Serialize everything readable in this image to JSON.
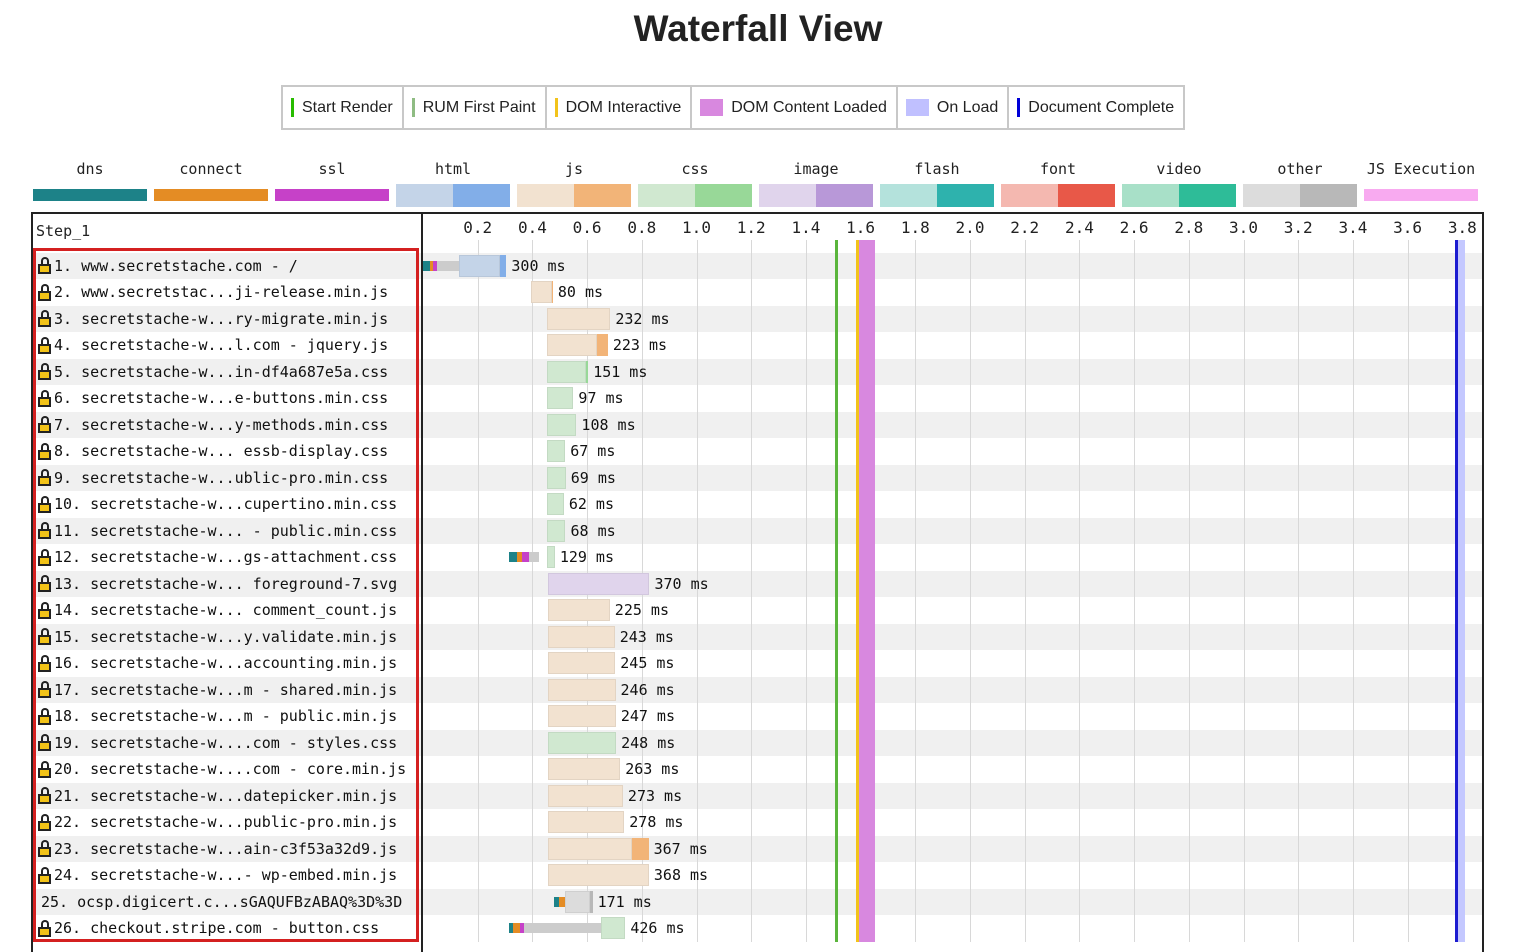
{
  "title": "Waterfall View",
  "timing_legend": [
    {
      "label": "Start Render",
      "color": "#28bc00",
      "style": "line"
    },
    {
      "label": "RUM First Paint",
      "color": "#8fbc83",
      "style": "line"
    },
    {
      "label": "DOM Interactive",
      "color": "#f2c31b",
      "style": "line"
    },
    {
      "label": "DOM Content Loaded",
      "color": "#d888df",
      "style": "box"
    },
    {
      "label": "On Load",
      "color": "#c0c0ff",
      "style": "box"
    },
    {
      "label": "Document Complete",
      "color": "#0000d8",
      "style": "line"
    }
  ],
  "request_types": [
    {
      "name": "dns",
      "light": "#1d8288",
      "dark": "#1d8288"
    },
    {
      "name": "connect",
      "light": "#e48c24",
      "dark": "#e48c24"
    },
    {
      "name": "ssl",
      "light": "#c641c8",
      "dark": "#c641c8"
    },
    {
      "name": "html",
      "light": "#c4d4e8",
      "dark": "#82aee8"
    },
    {
      "name": "js",
      "light": "#f2e2d0",
      "dark": "#f2b478"
    },
    {
      "name": "css",
      "light": "#d0e8d0",
      "dark": "#98d898"
    },
    {
      "name": "image",
      "light": "#e0d4ec",
      "dark": "#b898d8"
    },
    {
      "name": "flash",
      "light": "#b4e2dc",
      "dark": "#2eb2ad"
    },
    {
      "name": "font",
      "light": "#f4b8b0",
      "dark": "#e85848"
    },
    {
      "name": "video",
      "light": "#a8e0c8",
      "dark": "#2ebc98"
    },
    {
      "name": "other",
      "light": "#dcdcdc",
      "dark": "#b8b8b8"
    },
    {
      "name": "JS Execution",
      "light": "#f8aaf0",
      "dark": "#f8aaf0"
    }
  ],
  "step_label": "Step_1",
  "axis": {
    "ticks": [
      "0.2",
      "0.4",
      "0.6",
      "0.8",
      "1.0",
      "1.2",
      "1.4",
      "1.6",
      "1.8",
      "2.0",
      "2.2",
      "2.4",
      "2.6",
      "2.8",
      "3.0",
      "3.2",
      "3.4",
      "3.6",
      "3.8"
    ],
    "range_seconds": [
      0,
      3.85
    ]
  },
  "markers": [
    {
      "name": "start-render",
      "time": 1.506,
      "color": "#5ab53c",
      "kind": "line"
    },
    {
      "name": "dom-interactive",
      "time": 1.585,
      "color": "#f2c31b",
      "kind": "line"
    },
    {
      "name": "dom-content-loaded",
      "time_start": 1.593,
      "time_end": 1.653,
      "color": "#d888df",
      "kind": "band"
    },
    {
      "name": "document-complete",
      "time": 3.775,
      "color": "#1c1cd0",
      "kind": "line"
    },
    {
      "name": "on-load",
      "time_start": 3.783,
      "time_end": 3.81,
      "color": "#c4c8ff",
      "kind": "band"
    }
  ],
  "requests": [
    {
      "num": "1.",
      "label": "www.secretstache.com - /",
      "secure": true,
      "type": "html",
      "duration": "300 ms",
      "pre": [
        0.0,
        0.025,
        0.038,
        0.05,
        0.13
      ],
      "start": 0.13,
      "ttfb_end": 0.28,
      "end": 0.305
    },
    {
      "num": "2.",
      "label": "www.secretstac...ji-release.min.js",
      "secure": true,
      "type": "js",
      "duration": "80 ms",
      "start": 0.395,
      "ttfb_end": 0.47,
      "end": 0.475
    },
    {
      "num": "3.",
      "label": "secretstache-w...ry-migrate.min.js",
      "secure": true,
      "type": "js",
      "duration": "232 ms",
      "start": 0.453,
      "ttfb_end": 0.685,
      "end": 0.685
    },
    {
      "num": "4.",
      "label": "secretstache-w...l.com - jquery.js",
      "secure": true,
      "type": "js",
      "duration": "223 ms",
      "start": 0.453,
      "ttfb_end": 0.635,
      "end": 0.676
    },
    {
      "num": "5.",
      "label": "secretstache-w...in-df4a687e5a.css",
      "secure": true,
      "type": "css",
      "duration": "151 ms",
      "start": 0.453,
      "ttfb_end": 0.595,
      "end": 0.604
    },
    {
      "num": "6.",
      "label": "secretstache-w...e-buttons.min.css",
      "secure": true,
      "type": "css",
      "duration": "97 ms",
      "start": 0.453,
      "ttfb_end": 0.55,
      "end": 0.55
    },
    {
      "num": "7.",
      "label": "secretstache-w...y-methods.min.css",
      "secure": true,
      "type": "css",
      "duration": "108 ms",
      "start": 0.453,
      "ttfb_end": 0.561,
      "end": 0.561
    },
    {
      "num": "8.",
      "label": "secretstache-w... essb-display.css",
      "secure": true,
      "type": "css",
      "duration": "67 ms",
      "start": 0.453,
      "ttfb_end": 0.52,
      "end": 0.52
    },
    {
      "num": "9.",
      "label": "secretstache-w...ublic-pro.min.css",
      "secure": true,
      "type": "css",
      "duration": "69 ms",
      "start": 0.453,
      "ttfb_end": 0.522,
      "end": 0.522
    },
    {
      "num": "10.",
      "label": "secretstache-w...cupertino.min.css",
      "secure": true,
      "type": "css",
      "duration": "62 ms",
      "start": 0.453,
      "ttfb_end": 0.515,
      "end": 0.515
    },
    {
      "num": "11.",
      "label": "secretstache-w... - public.min.css",
      "secure": true,
      "type": "css",
      "duration": "68 ms",
      "start": 0.453,
      "ttfb_end": 0.521,
      "end": 0.521
    },
    {
      "num": "12.",
      "label": "secretstache-w...gs-attachment.css",
      "secure": true,
      "type": "css",
      "duration": "129 ms",
      "pre": [
        0.314,
        0.344,
        0.363,
        0.388,
        0.423
      ],
      "start": 0.453,
      "ttfb_end": 0.482,
      "end": 0.482
    },
    {
      "num": "13.",
      "label": "secretstache-w... foreground-7.svg",
      "secure": true,
      "type": "image",
      "duration": "370 ms",
      "start": 0.458,
      "ttfb_end": 0.828,
      "end": 0.828
    },
    {
      "num": "14.",
      "label": "secretstache-w... comment_count.js",
      "secure": true,
      "type": "js",
      "duration": "225 ms",
      "start": 0.458,
      "ttfb_end": 0.683,
      "end": 0.683
    },
    {
      "num": "15.",
      "label": "secretstache-w...y.validate.min.js",
      "secure": true,
      "type": "js",
      "duration": "243 ms",
      "start": 0.458,
      "ttfb_end": 0.701,
      "end": 0.701
    },
    {
      "num": "16.",
      "label": "secretstache-w...accounting.min.js",
      "secure": true,
      "type": "js",
      "duration": "245 ms",
      "start": 0.458,
      "ttfb_end": 0.703,
      "end": 0.703
    },
    {
      "num": "17.",
      "label": "secretstache-w...m - shared.min.js",
      "secure": true,
      "type": "js",
      "duration": "246 ms",
      "start": 0.458,
      "ttfb_end": 0.704,
      "end": 0.704
    },
    {
      "num": "18.",
      "label": "secretstache-w...m - public.min.js",
      "secure": true,
      "type": "js",
      "duration": "247 ms",
      "start": 0.458,
      "ttfb_end": 0.705,
      "end": 0.705
    },
    {
      "num": "19.",
      "label": "secretstache-w....com - styles.css",
      "secure": true,
      "type": "css",
      "duration": "248 ms",
      "start": 0.458,
      "ttfb_end": 0.706,
      "end": 0.706
    },
    {
      "num": "20.",
      "label": "secretstache-w....com - core.min.js",
      "secure": true,
      "type": "js",
      "duration": "263 ms",
      "start": 0.458,
      "ttfb_end": 0.721,
      "end": 0.721
    },
    {
      "num": "21.",
      "label": "secretstache-w...datepicker.min.js",
      "secure": true,
      "type": "js",
      "duration": "273 ms",
      "start": 0.458,
      "ttfb_end": 0.731,
      "end": 0.731
    },
    {
      "num": "22.",
      "label": "secretstache-w...public-pro.min.js",
      "secure": true,
      "type": "js",
      "duration": "278 ms",
      "start": 0.458,
      "ttfb_end": 0.736,
      "end": 0.736
    },
    {
      "num": "23.",
      "label": "secretstache-w...ain-c3f53a32d9.js",
      "secure": true,
      "type": "js",
      "duration": "367 ms",
      "start": 0.458,
      "ttfb_end": 0.763,
      "end": 0.825
    },
    {
      "num": "24.",
      "label": "secretstache-w...- wp-embed.min.js",
      "secure": true,
      "type": "js",
      "duration": "368 ms",
      "start": 0.458,
      "ttfb_end": 0.826,
      "end": 0.826
    },
    {
      "num": "25.",
      "label": "ocsp.digicert.c...sGAQUFBzABAQ%3D%3D",
      "secure": false,
      "type": "other",
      "duration": "171 ms",
      "pre": [
        0.478,
        0.498,
        0.518,
        0.518,
        0.518
      ],
      "start": 0.518,
      "ttfb_end": 0.611,
      "end": 0.62
    },
    {
      "num": "26.",
      "label": "checkout.stripe.com - button.css",
      "secure": true,
      "type": "css",
      "duration": "426 ms",
      "pre": [
        0.314,
        0.33,
        0.353,
        0.37,
        0.65
      ],
      "start": 0.65,
      "ttfb_end": 0.74,
      "end": 0.74
    }
  ]
}
